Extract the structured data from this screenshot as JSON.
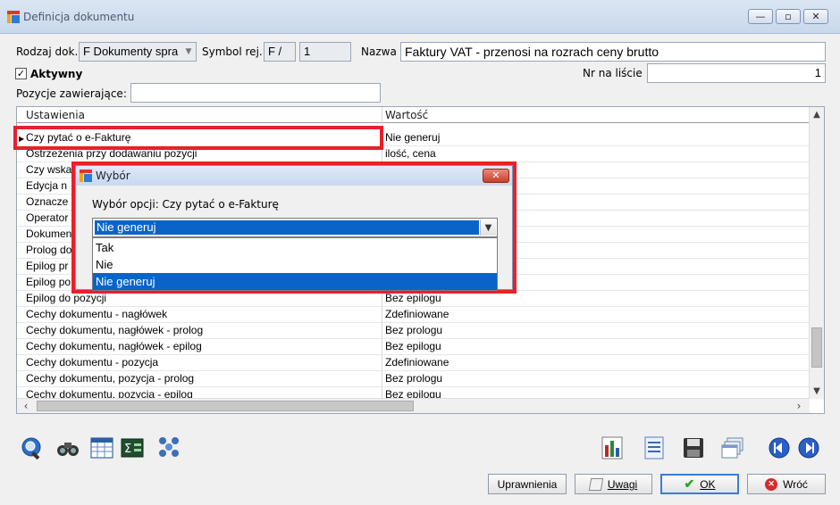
{
  "window": {
    "title": "Definicja dokumentu",
    "minimize": "—",
    "restore": "▫",
    "close": "✕"
  },
  "form": {
    "rodzaj_label": "Rodzaj dok.",
    "rodzaj_value": "F Dokumenty spra",
    "symbol_label": "Symbol rej.",
    "symbol_value": "F /",
    "symbol_num": "1",
    "nazwa_label": "Nazwa",
    "nazwa_value": "Faktury VAT - przenosi na rozrach ceny brutto",
    "aktywny_label": "Aktywny",
    "nr_label": "Nr na liście",
    "nr_value": "1",
    "pozycje_label": "Pozycje zawierające:",
    "pozycje_value": ""
  },
  "grid": {
    "col1": "Ustawienia",
    "col2": "Wartość",
    "rows": [
      {
        "name": "Czy pytać o e-Fakturę",
        "value": "Nie generuj"
      },
      {
        "name": "Ostrzeżenia przy dodawaniu pozycji",
        "value": "ilość, cena"
      },
      {
        "name": "Czy wska",
        "value": ""
      },
      {
        "name": "Edycja n",
        "value": ""
      },
      {
        "name": "Oznacze",
        "value": ""
      },
      {
        "name": "Operator",
        "value": ""
      },
      {
        "name": "Dokumen",
        "value": ""
      },
      {
        "name": "Prolog do",
        "value": ""
      },
      {
        "name": "Epilog pr",
        "value": ""
      },
      {
        "name": "Epilog po kor",
        "value": ""
      },
      {
        "name": "Epilog do pozycji",
        "value": "Bez epilogu"
      },
      {
        "name": "Cechy dokumentu - nagłówek",
        "value": "Zdefiniowane"
      },
      {
        "name": "Cechy dokumentu, nagłówek - prolog",
        "value": "Bez prologu"
      },
      {
        "name": "Cechy dokumentu, nagłówek - epilog",
        "value": "Bez epilogu"
      },
      {
        "name": "Cechy dokumentu - pozycja",
        "value": "Zdefiniowane"
      },
      {
        "name": "Cechy dokumentu, pozycja - prolog",
        "value": "Bez prologu"
      },
      {
        "name": "Cechy dokumentu, pozycja - epilog",
        "value": "Bez epilogu"
      }
    ]
  },
  "dialog": {
    "title": "Wybór",
    "label": "Wybór opcji:  Czy pytać o e-Fakturę",
    "selected": "Nie generuj",
    "options": [
      "Tak",
      "Nie",
      "Nie generuj"
    ]
  },
  "buttons": {
    "uprawnienia": "Uprawnienia",
    "uwagi": "Uwagi",
    "ok": "OK",
    "wroc": "Wróć"
  },
  "colors": {
    "highlight": "#e8202a",
    "selection": "#0a64c8"
  }
}
